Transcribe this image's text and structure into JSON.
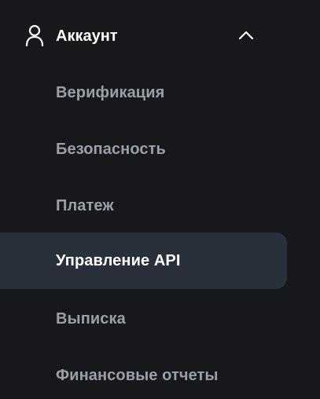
{
  "section": {
    "title": "Аккаунт",
    "icon": "user-icon",
    "toggle_icon": "chevron-up-icon",
    "expanded": true
  },
  "menu": {
    "items": [
      {
        "label": "Верификация",
        "active": false
      },
      {
        "label": "Безопасность",
        "active": false
      },
      {
        "label": "Платеж",
        "active": false
      },
      {
        "label": "Управление API",
        "active": true
      },
      {
        "label": "Выписка",
        "active": false
      },
      {
        "label": "Финансовые отчеты",
        "active": false
      }
    ]
  },
  "colors": {
    "background": "#17181c",
    "active_background": "#2a303a",
    "active_text": "#ffffff",
    "inactive_text": "#9aa0a8"
  }
}
